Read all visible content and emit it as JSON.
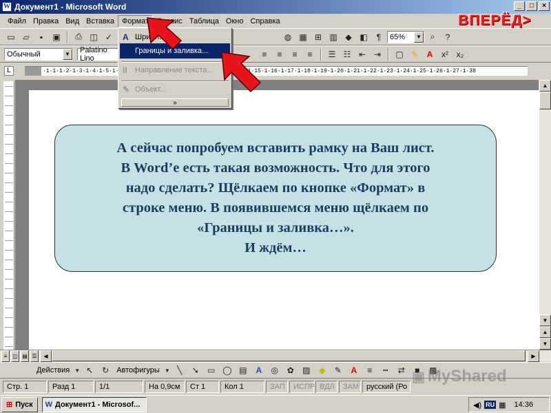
{
  "window": {
    "title": "Документ1 - Microsoft Word",
    "controls": [
      "_",
      "□",
      "×"
    ]
  },
  "menubar": {
    "items": [
      "Файл",
      "Правка",
      "Вид",
      "Вставка",
      "Формат",
      "Сервис",
      "Таблица",
      "Окно",
      "Справка"
    ],
    "active": "Формат"
  },
  "toolbar_standard": {
    "zoom": "65%"
  },
  "toolbar_formatting": {
    "style": "Обычный",
    "font": "Palatino Lino"
  },
  "nav_button": {
    "label": "ВПЕРЁД>"
  },
  "format_menu": {
    "items": [
      {
        "icon": "A",
        "label": "Шрифт...",
        "state": "normal"
      },
      {
        "icon": "",
        "label": "Границы и заливка...",
        "state": "selected"
      },
      {
        "icon": "II",
        "label": "Направление текста...",
        "state": "disabled"
      },
      {
        "icon": "✎",
        "label": "Объект...",
        "state": "disabled"
      }
    ],
    "expand": "»"
  },
  "ruler": {
    "text": "·1·1·1·2·1·3·1·4·1·5·1·6·1·7·1·8·1·9·1·10·1·11·1·12·1·13·1·14·1·15·1·16·1·17·1·18·1·19·1·20·1·21·1·22·1·23·1·24·1·25·1·26·1·27·1·38"
  },
  "callout": {
    "lines": [
      "А сейчас попробуем вставить рамку на Ваш лист.",
      "В Word’е есть такая возможность. Что для этого",
      "надо сделать? Щёлкаем по кнопке «Формат» в",
      "строке меню. В появившемся меню щёлкаем по",
      "«Границы и заливка…».",
      "И ждём…"
    ]
  },
  "drawing_toolbar": {
    "actions": "Действия",
    "autoshapes": "Автофигуры"
  },
  "statusbar": {
    "page": "Стр. 1",
    "section": "Разд 1",
    "pages": "1/1",
    "at": "На 0,9см",
    "line": "Ст 1",
    "col": "Кол 1",
    "rec": "ЗАП",
    "trk": "ИСПР",
    "ext": "ВДЛ",
    "ovr": "ЗАМ",
    "lang": "русский (Ро"
  },
  "watermark": {
    "text": "MyShared"
  },
  "taskbar": {
    "start": "Пуск",
    "task": "Документ1 - Microsof...",
    "lang": "RU",
    "clock": "14:36"
  },
  "colors": {
    "titlebar_start": "#0a246a",
    "callout_fill": "#c4e2e6",
    "callout_text": "#1f3a5f",
    "arrow": "#e8141c",
    "vpered": "#ff1a1a"
  }
}
